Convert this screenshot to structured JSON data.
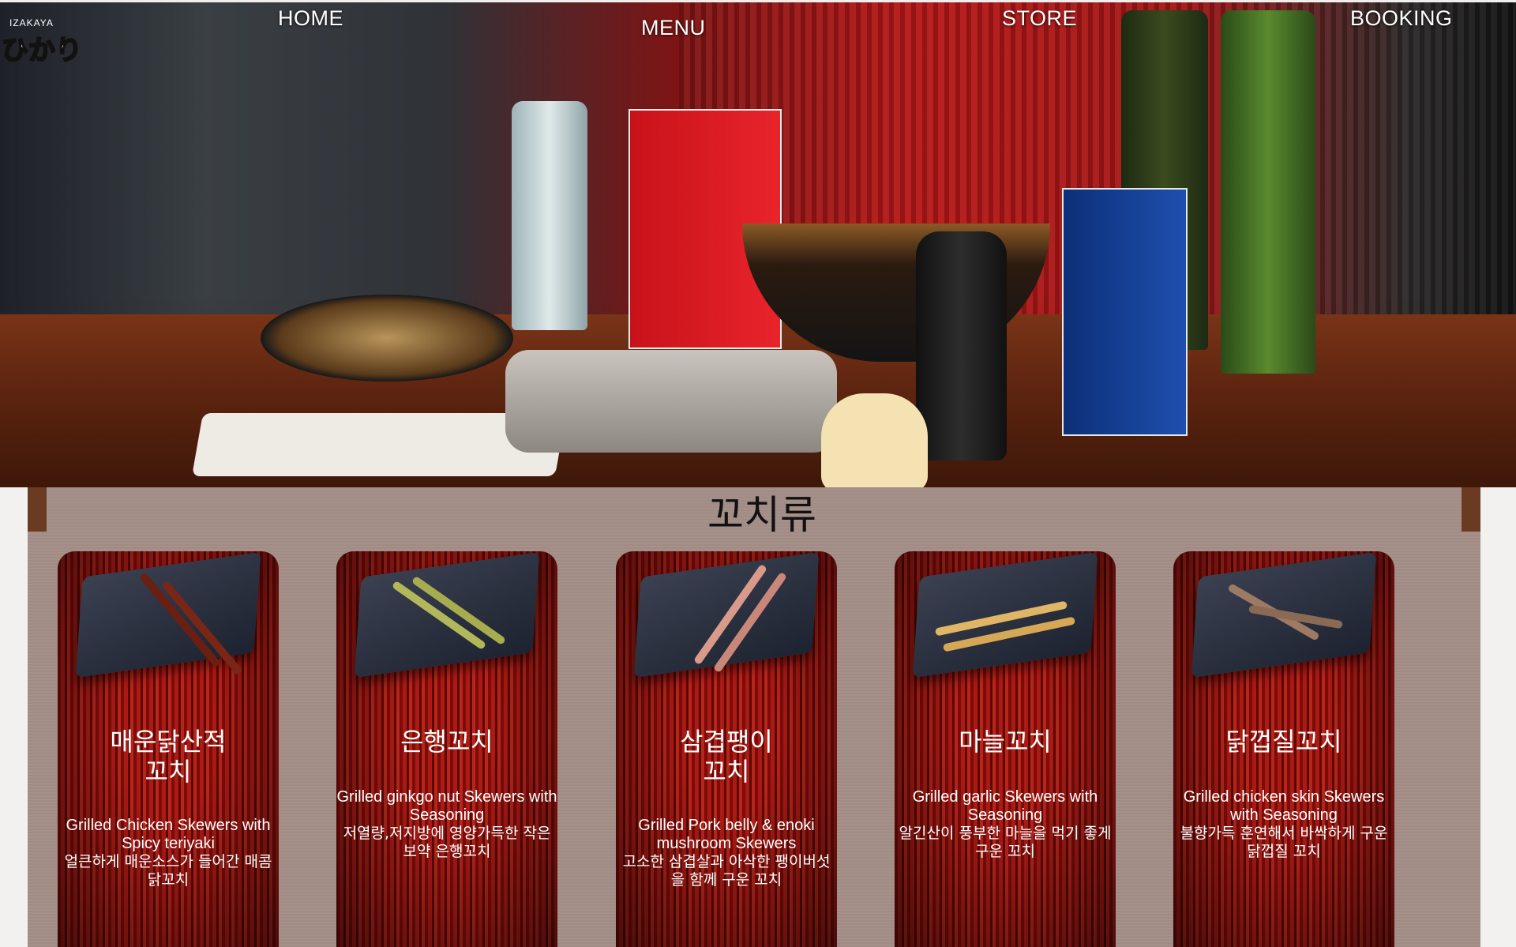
{
  "brand": {
    "small": "IZAKAYA",
    "big": "ひかり"
  },
  "nav": {
    "home": "HOME",
    "menu": "MENU",
    "store": "STORE",
    "booking": "BOOKING"
  },
  "section": {
    "title": "꼬치류"
  },
  "cards": [
    {
      "name": "매운닭산적\n꼬치",
      "en": "Grilled Chicken Skewers with Spicy teriyaki",
      "ko": "얼큰하게 매운소스가 들어간 매콤 닭꼬치"
    },
    {
      "name": "은행꼬치",
      "en": "Grilled ginkgo nut Skewers with Seasoning",
      "ko": "저열량,저지방에 영양가득한 작은 보약 은행꼬치"
    },
    {
      "name": "삼겹팽이\n꼬치",
      "en": "Grilled Pork belly & enoki mushroom Skewers",
      "ko": "고소한 삼겹살과 아삭한 팽이버섯을 함께 구운 꼬치"
    },
    {
      "name": "마늘꼬치",
      "en": "Grilled garlic Skewers with Seasoning",
      "ko": "알긴산이 풍부한 마늘을 먹기 좋게 구운 꼬치"
    },
    {
      "name": "닭껍질꼬치",
      "en": "Grilled chicken skin Skewers with Seasoning",
      "ko": "불향가득 훈연해서 바싹하게 구운 닭껍질 꼬치"
    }
  ]
}
